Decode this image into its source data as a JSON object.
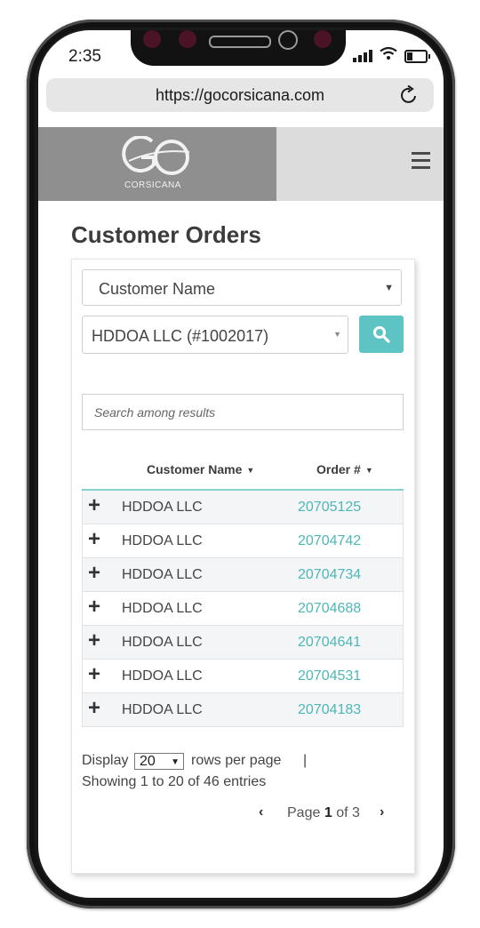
{
  "status_bar": {
    "time": "2:35"
  },
  "browser": {
    "url": "https://gocorsicana.com"
  },
  "site_header": {
    "logo_text": "CORSICANA"
  },
  "page": {
    "title": "Customer Orders"
  },
  "filters": {
    "field_select": "Customer Name",
    "customer_select": "HDDOA LLC (#1002017)",
    "search_placeholder": "Search among results"
  },
  "table": {
    "columns": [
      "Customer Name",
      "Order #"
    ],
    "rows": [
      {
        "customer": "HDDOA LLC",
        "order": "20705125"
      },
      {
        "customer": "HDDOA LLC",
        "order": "20704742"
      },
      {
        "customer": "HDDOA LLC",
        "order": "20704734"
      },
      {
        "customer": "HDDOA LLC",
        "order": "20704688"
      },
      {
        "customer": "HDDOA LLC",
        "order": "20704641"
      },
      {
        "customer": "HDDOA LLC",
        "order": "20704531"
      },
      {
        "customer": "HDDOA LLC",
        "order": "20704183"
      }
    ]
  },
  "pagination": {
    "display_label": "Display",
    "rows_per_page_value": "20",
    "rows_label": "rows per page",
    "separator": "|",
    "showing": "Showing 1 to 20 of 46 entries",
    "page_label": "Page",
    "current_page": "1",
    "of_label": "of 3"
  },
  "colors": {
    "accent": "#5ec4c3",
    "link": "#4db7b6",
    "logo_bg": "#8f8f8f"
  }
}
